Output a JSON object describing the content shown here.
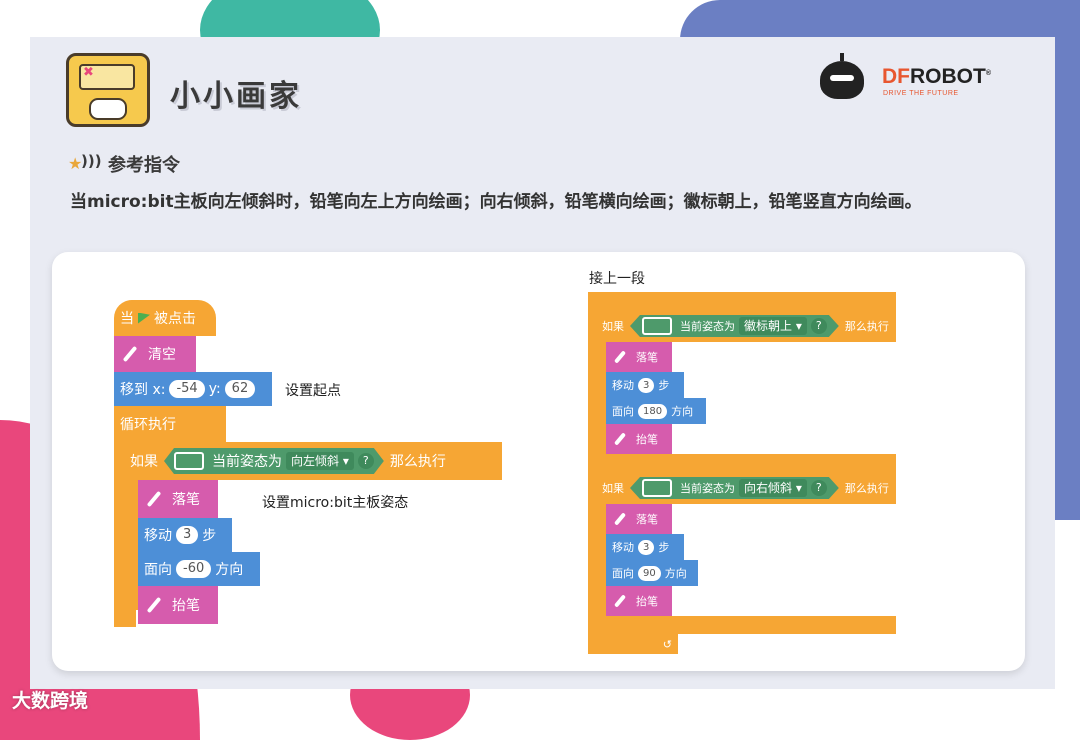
{
  "header": {
    "title": "小小画家"
  },
  "brand": {
    "name_df": "DF",
    "name_rest": "ROBOT",
    "registered": "®",
    "tagline": "DRIVE THE FUTURE"
  },
  "section": {
    "title": "参考指令"
  },
  "description": "当micro:bit主板向左倾斜时，铅笔向左上方向绘画；向右倾斜，铅笔横向绘画；徽标朝上，铅笔竖直方向绘画。",
  "left_script": {
    "when_label": "当",
    "clicked_label": "被点击",
    "clear_label": "清空",
    "goto_label": "移到 x:",
    "goto_x": "-54",
    "goto_y_label": "y:",
    "goto_y": "62",
    "loop_label": "循环执行",
    "if_label": "如果",
    "pose_label": "当前姿态为",
    "pose_value": "向左倾斜 ▾",
    "q": "?",
    "then_label": "那么执行",
    "pen_down": "落笔",
    "move_label": "移动",
    "move_value": "3",
    "steps_label": "步",
    "face_label": "面向",
    "face_value": "-60",
    "dir_label": "方向",
    "pen_up": "抬笔"
  },
  "right_script": {
    "if_label": "如果",
    "pose_label": "当前姿态为",
    "q": "?",
    "then_label": "那么执行",
    "pen_down": "落笔",
    "move_label": "移动",
    "steps_label": "步",
    "face_label": "面向",
    "dir_label": "方向",
    "pen_up": "抬笔",
    "block1": {
      "pose_value": "徽标朝上 ▾",
      "move_value": "3",
      "face_value": "180"
    },
    "block2": {
      "pose_value": "向右倾斜 ▾",
      "move_value": "3",
      "face_value": "90"
    }
  },
  "notes": {
    "start_point": "设置起点",
    "set_pose": "设置micro:bit主板姿态",
    "continue": "接上一段"
  },
  "watermark": "大数跨境",
  "colors": {
    "event": "#f6a634",
    "pen": "#d65cad",
    "motion": "#4d8fd7",
    "sensor": "#4e9a6b"
  }
}
